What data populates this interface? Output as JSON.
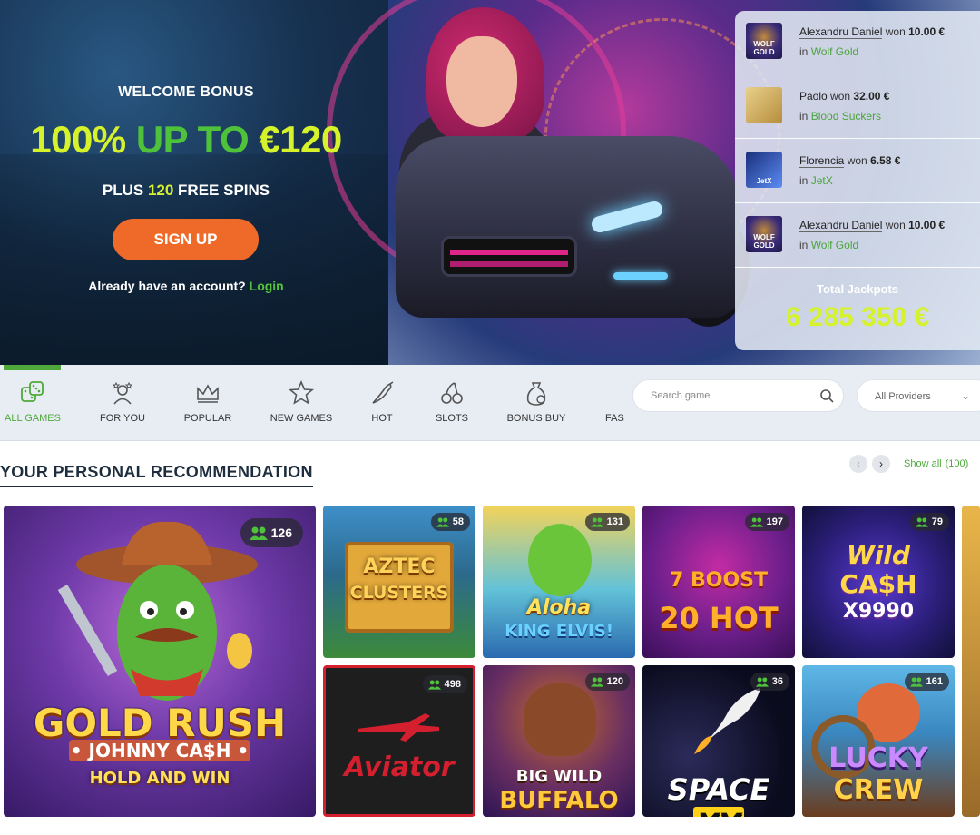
{
  "hero": {
    "welcome": "WELCOME BONUS",
    "headline_part1": "100%",
    "headline_part2": "UP TO",
    "headline_part3": "€120",
    "plus_pre": "PLUS",
    "plus_num": "120",
    "plus_post": "FREE SPINS",
    "signup": "SIGN UP",
    "already": "Already have an account?",
    "login": "Login"
  },
  "winners": [
    {
      "name": "Alexandru Daniel",
      "won": "won",
      "amount": "10.00 €",
      "in": "in",
      "game": "Wolf Gold",
      "icon": "wolf-gold-thumbnail"
    },
    {
      "name": "Paolo",
      "won": "won",
      "amount": "32.00 €",
      "in": "in",
      "game": "Blood Suckers",
      "icon": "blood-suckers-thumbnail"
    },
    {
      "name": "Florencia",
      "won": "won",
      "amount": "6.58 €",
      "in": "in",
      "game": "JetX",
      "icon": "jetx-thumbnail"
    },
    {
      "name": "Alexandru Daniel",
      "won": "won",
      "amount": "10.00 €",
      "in": "in",
      "game": "Wolf Gold",
      "icon": "wolf-gold-thumbnail"
    }
  ],
  "jackpot": {
    "label": "Total Jackpots",
    "value": "6 285 350 €"
  },
  "categories": [
    {
      "label": "ALL GAMES",
      "icon": "dice-icon",
      "active": true
    },
    {
      "label": "FOR YOU",
      "icon": "person-star-icon"
    },
    {
      "label": "POPULAR",
      "icon": "crown-icon"
    },
    {
      "label": "NEW GAMES",
      "icon": "star-icon"
    },
    {
      "label": "HOT",
      "icon": "chili-icon"
    },
    {
      "label": "SLOTS",
      "icon": "cherries-icon"
    },
    {
      "label": "BONUS BUY",
      "icon": "money-bag-icon"
    },
    {
      "label": "FAS"
    }
  ],
  "search": {
    "placeholder": "Search game"
  },
  "providers": {
    "value": "All Providers"
  },
  "recommendation": {
    "title": "YOUR PERSONAL RECOMMENDATION",
    "show_all": "Show all",
    "count": "(100)"
  },
  "games": [
    {
      "name": "Gold Rush Johnny Cash",
      "players": "126",
      "line1": "GOLD RUSH",
      "line2": "• JOHNNY CA$H •",
      "line3": "HOLD AND WIN"
    },
    {
      "name": "Aztec Clusters",
      "players": "58",
      "line1": "AZTEC",
      "line2": "CLUSTERS"
    },
    {
      "name": "Aloha King Elvis",
      "players": "131",
      "line1": "Aloha",
      "line2": "KING ELVIS!"
    },
    {
      "name": "20 Boost Hot",
      "players": "197",
      "line1": "7 BOOST",
      "line2": "20 HOT"
    },
    {
      "name": "Wild Cash x9990",
      "players": "79",
      "line1": "Wild",
      "line2": "CA$H",
      "line3": "X9990"
    },
    {
      "name": "Aviator",
      "players": "498",
      "line1": "Aviator"
    },
    {
      "name": "Big Wild Buffalo",
      "players": "120",
      "line1": "BIG WILD",
      "line2": "BUFFALO"
    },
    {
      "name": "Space XY",
      "players": "36",
      "line1": "SPACE",
      "line2": "XY"
    },
    {
      "name": "Lucky Crew",
      "players": "161",
      "line1": "LUCKY",
      "line2": "CREW"
    }
  ]
}
